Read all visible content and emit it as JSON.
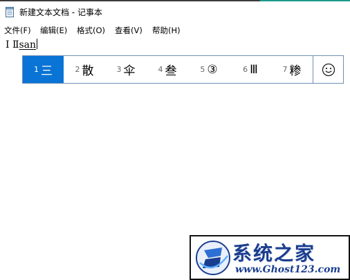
{
  "window": {
    "title": "新建文本文档 - 记事本",
    "icon": "notepad-icon"
  },
  "menubar": {
    "items": [
      "文件(F)",
      "编辑(E)",
      "格式(O)",
      "查看(V)",
      "帮助(H)"
    ]
  },
  "editor": {
    "committed_text": "Ⅰ Ⅱ",
    "composition_text": "san"
  },
  "ime": {
    "selected_index": 0,
    "candidates": [
      {
        "num": "1",
        "text": "三"
      },
      {
        "num": "2",
        "text": "散"
      },
      {
        "num": "3",
        "text": "伞"
      },
      {
        "num": "4",
        "text": "叁"
      },
      {
        "num": "5",
        "text": "③"
      },
      {
        "num": "6",
        "text": "Ⅲ"
      },
      {
        "num": "7",
        "text": "糁"
      }
    ],
    "emoji_icon": "smiley-icon",
    "selected_color": "#0a74d6"
  },
  "watermark": {
    "title": "系统之家",
    "url": "www.Ghost123.com",
    "brand_color": "#1a3d8f"
  }
}
